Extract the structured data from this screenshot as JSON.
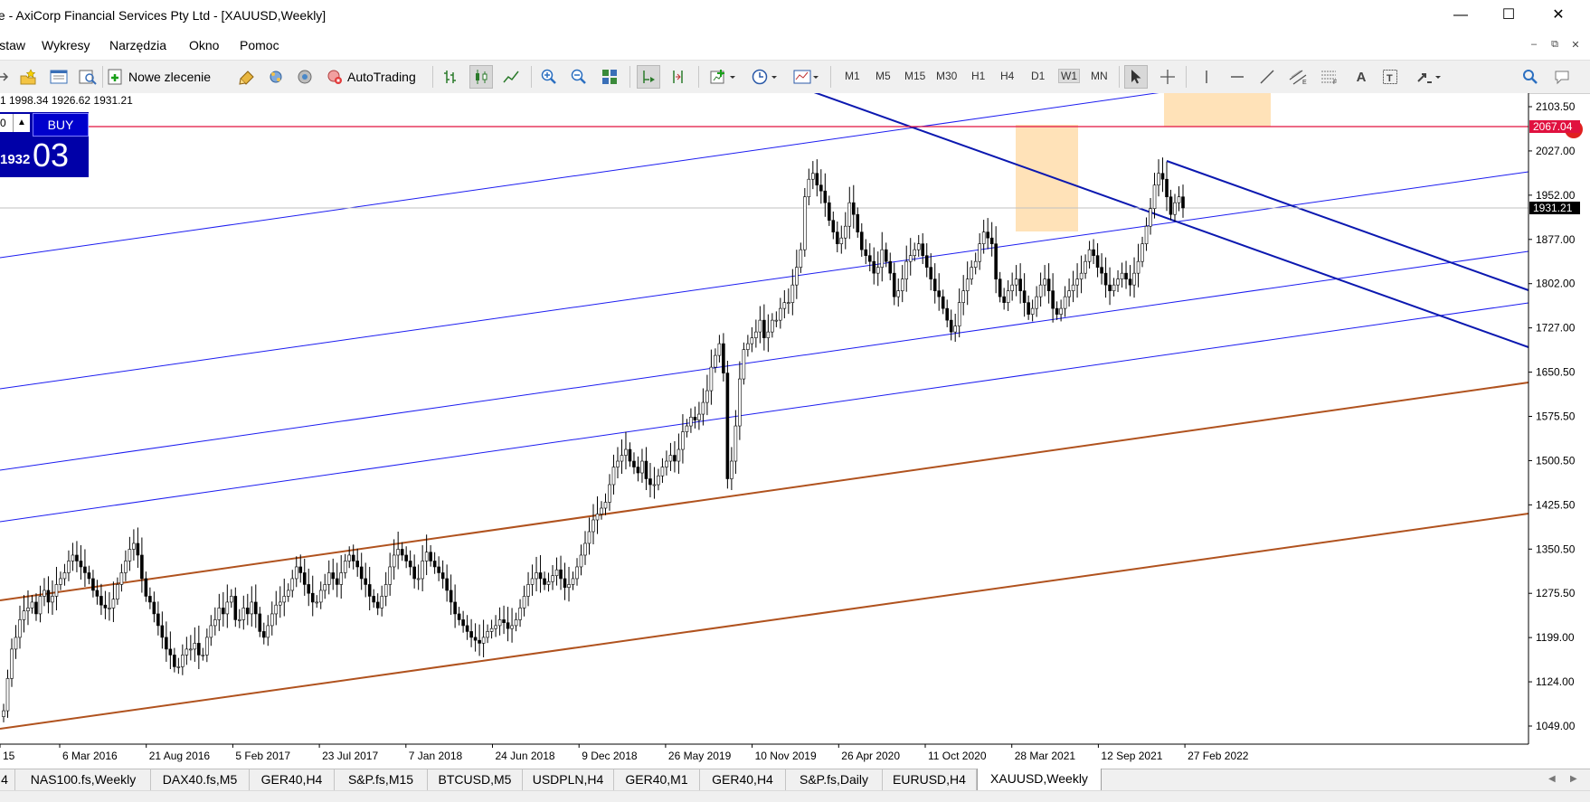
{
  "window": {
    "title": "Live - AxiCorp Financial Services Pty Ltd - [XAUUSD,Weekly]",
    "minimize": "—",
    "maximize": "☐",
    "close": "✕"
  },
  "menu": {
    "items": [
      "Wstaw",
      "Wykresy",
      "Narzędzia",
      "Okno",
      "Pomoc"
    ],
    "mdi": [
      "–",
      "⧉",
      "✕"
    ]
  },
  "toolbar": {
    "new_order_label": "Nowe zlecenie",
    "autotrading_label": "AutoTrading",
    "timeframes": [
      "M1",
      "M5",
      "M15",
      "M30",
      "H1",
      "H4",
      "D1",
      "W1",
      "MN"
    ],
    "active_timeframe": "W1",
    "notification_count": "1"
  },
  "chart": {
    "ohlc_text": "1 1998.34 1926.62 1931.21",
    "one_click": {
      "lots": "0",
      "buy_label": "BUY",
      "price_small": "1932",
      "price_big": "03"
    },
    "price_labels": [
      "2103.50",
      "2027.00",
      "1952.00",
      "1877.00",
      "1802.00",
      "1727.00",
      "1650.50",
      "1575.50",
      "1500.50",
      "1425.50",
      "1350.50",
      "1275.50",
      "1199.00",
      "1124.00",
      "1049.00"
    ],
    "hline_label": "2067.04",
    "current_price": "1931.21",
    "date_labels": [
      "15",
      "6 Mar 2016",
      "21 Aug 2016",
      "5 Feb 2017",
      "23 Jul 2017",
      "7 Jan 2018",
      "24 Jun 2018",
      "9 Dec 2018",
      "26 May 2019",
      "10 Nov 2019",
      "26 Apr 2020",
      "11 Oct 2020",
      "28 Mar 2021",
      "12 Sep 2021",
      "27 Feb 2022"
    ],
    "colors": {
      "hline": "#e0113f",
      "channel_blue": "#1c1cf0",
      "trend_dark_blue": "#0b18b0",
      "channel_brown": "#b0521e",
      "highlight": "#ffe2b8"
    }
  },
  "chart_data": {
    "type": "candlestick",
    "symbol": "XAUUSD",
    "timeframe": "Weekly",
    "ylim": [
      1010,
      2135
    ],
    "closes": [
      1075,
      1130,
      1180,
      1200,
      1230,
      1245,
      1250,
      1260,
      1240,
      1270,
      1280,
      1260,
      1270,
      1290,
      1300,
      1310,
      1330,
      1340,
      1330,
      1320,
      1310,
      1300,
      1280,
      1270,
      1255,
      1250,
      1250,
      1265,
      1290,
      1310,
      1330,
      1350,
      1360,
      1340,
      1300,
      1270,
      1260,
      1240,
      1220,
      1200,
      1180,
      1170,
      1150,
      1150,
      1170,
      1180,
      1180,
      1190,
      1170,
      1170,
      1200,
      1220,
      1230,
      1250,
      1240,
      1260,
      1270,
      1230,
      1230,
      1250,
      1240,
      1260,
      1240,
      1210,
      1200,
      1220,
      1240,
      1255,
      1260,
      1270,
      1280,
      1300,
      1320,
      1310,
      1290,
      1275,
      1260,
      1260,
      1280,
      1290,
      1310,
      1300,
      1290,
      1310,
      1330,
      1340,
      1330,
      1320,
      1300,
      1290,
      1270,
      1260,
      1250,
      1270,
      1290,
      1320,
      1340,
      1350,
      1340,
      1330,
      1320,
      1300,
      1300,
      1330,
      1345,
      1330,
      1320,
      1310,
      1300,
      1280,
      1260,
      1240,
      1230,
      1220,
      1210,
      1200,
      1195,
      1190,
      1200,
      1210,
      1215,
      1220,
      1230,
      1225,
      1215,
      1220,
      1230,
      1250,
      1270,
      1290,
      1300,
      1310,
      1300,
      1290,
      1295,
      1305,
      1315,
      1300,
      1285,
      1290,
      1300,
      1320,
      1340,
      1360,
      1380,
      1400,
      1410,
      1420,
      1430,
      1460,
      1490,
      1500,
      1510,
      1520,
      1500,
      1490,
      1480,
      1500,
      1470,
      1460,
      1460,
      1475,
      1490,
      1500,
      1510,
      1500,
      1520,
      1550,
      1560,
      1575,
      1570,
      1580,
      1600,
      1620,
      1660,
      1680,
      1700,
      1650,
      1470,
      1500,
      1560,
      1640,
      1690,
      1700,
      1710,
      1720,
      1740,
      1710,
      1720,
      1740,
      1740,
      1760,
      1770,
      1770,
      1800,
      1830,
      1860,
      1950,
      1980,
      1990,
      1970,
      1960,
      1940,
      1910,
      1890,
      1870,
      1880,
      1900,
      1940,
      1920,
      1890,
      1860,
      1850,
      1840,
      1820,
      1830,
      1860,
      1840,
      1820,
      1780,
      1790,
      1810,
      1840,
      1850,
      1860,
      1870,
      1850,
      1830,
      1810,
      1790,
      1780,
      1760,
      1740,
      1720,
      1730,
      1770,
      1790,
      1810,
      1830,
      1840,
      1870,
      1890,
      1880,
      1870,
      1810,
      1780,
      1770,
      1790,
      1800,
      1810,
      1790,
      1770,
      1750,
      1760,
      1780,
      1800,
      1810,
      1790,
      1760,
      1750,
      1760,
      1780,
      1790,
      1800,
      1810,
      1820,
      1840,
      1860,
      1850,
      1830,
      1820,
      1800,
      1790,
      1800,
      1810,
      1820,
      1810,
      1800,
      1820,
      1840,
      1870,
      1900,
      1930,
      1970,
      1990,
      1980,
      1950,
      1920,
      1940,
      1950,
      1931.21
    ],
    "first_shown_bar_date": "~Nov 2015",
    "last_bar_date": "~Apr 2022",
    "horizontal_lines": [
      2067.04
    ],
    "last_close": 1931.21
  },
  "tabs": {
    "items": [
      "4",
      "NAS100.fs,Weekly",
      "DAX40.fs,M5",
      "GER40,H4",
      "S&P.fs,M15",
      "BTCUSD,M5",
      "USDPLN,H4",
      "GER40,M1",
      "GER40,H4",
      "S&P.fs,Daily",
      "EURUSD,H4",
      "XAUUSD,Weekly"
    ],
    "active": "XAUUSD,Weekly",
    "nav_left": "◀",
    "nav_right": "▶"
  }
}
